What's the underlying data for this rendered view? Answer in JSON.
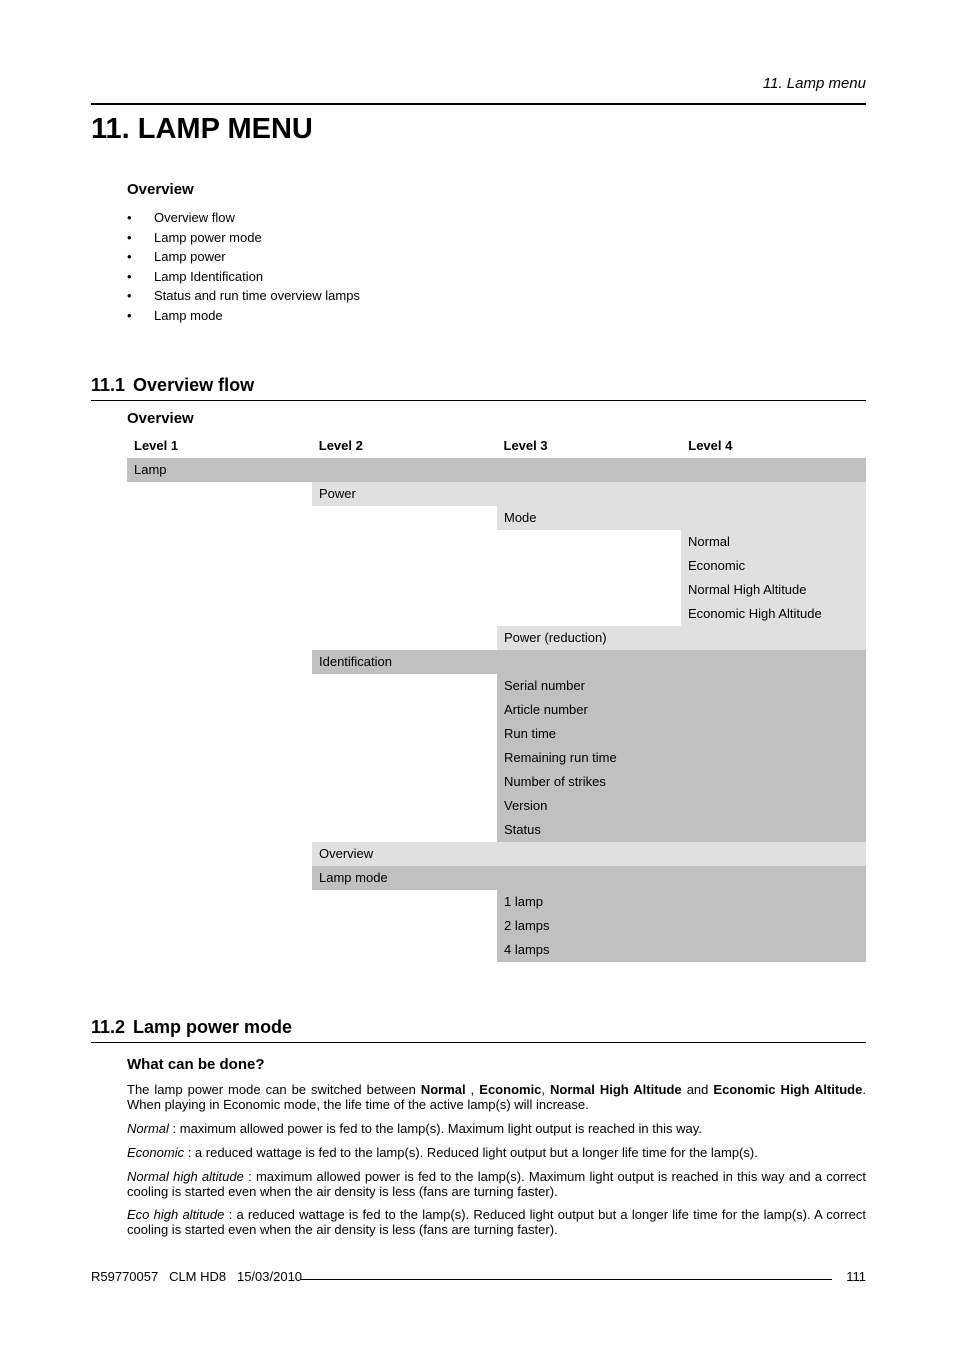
{
  "running_header": "11.  Lamp menu",
  "chapter_title": "11. LAMP MENU",
  "overview": {
    "heading": "Overview",
    "items": [
      "Overview flow",
      "Lamp power mode",
      "Lamp power",
      "Lamp Identification",
      "Status and run time overview lamps",
      "Lamp mode"
    ]
  },
  "section_1": {
    "number": "11.1",
    "title": "Overview flow",
    "subheading": "Overview",
    "columns": [
      "Level 1",
      "Level 2",
      "Level 3",
      "Level 4"
    ],
    "rows": [
      {
        "level": 1,
        "text": "Lamp",
        "shade": "dark"
      },
      {
        "level": 2,
        "text": "Power",
        "shade": "light"
      },
      {
        "level": 3,
        "text": "Mode",
        "shade": "light"
      },
      {
        "level": 4,
        "text": "Normal",
        "shade": "light"
      },
      {
        "level": 4,
        "text": "Economic",
        "shade": "light"
      },
      {
        "level": 4,
        "text": "Normal High Altitude",
        "shade": "light"
      },
      {
        "level": 4,
        "text": "Economic High Altitude",
        "shade": "light"
      },
      {
        "level": 3,
        "text": "Power (reduction)",
        "shade": "light"
      },
      {
        "level": 2,
        "text": "Identification",
        "shade": "dark"
      },
      {
        "level": 3,
        "text": "Serial number",
        "shade": "dark"
      },
      {
        "level": 3,
        "text": "Article number",
        "shade": "dark"
      },
      {
        "level": 3,
        "text": "Run time",
        "shade": "dark"
      },
      {
        "level": 3,
        "text": "Remaining run time",
        "shade": "dark"
      },
      {
        "level": 3,
        "text": "Number of strikes",
        "shade": "dark"
      },
      {
        "level": 3,
        "text": "Version",
        "shade": "dark"
      },
      {
        "level": 3,
        "text": "Status",
        "shade": "dark"
      },
      {
        "level": 2,
        "text": "Overview",
        "shade": "light"
      },
      {
        "level": 2,
        "text": "Lamp mode",
        "shade": "dark"
      },
      {
        "level": 3,
        "text": "1 lamp",
        "shade": "dark"
      },
      {
        "level": 3,
        "text": "2 lamps",
        "shade": "dark"
      },
      {
        "level": 3,
        "text": "4 lamps",
        "shade": "dark"
      }
    ]
  },
  "section_2": {
    "number": "11.2",
    "title": "Lamp power mode",
    "subheading": "What can be done?",
    "intro": {
      "t1": "The lamp power mode can be switched between ",
      "b1": "Normal",
      "t2": " , ",
      "b2": "Economic",
      "t3": ", ",
      "b3": "Normal High Altitude",
      "t4": " and ",
      "b4": "Economic High Altitude",
      "t5": ". When playing in Economic mode, the life time of the active lamp(s) will increase."
    },
    "definitions": [
      {
        "term": "Normal",
        "sep": " : ",
        "text": "maximum allowed power is fed to the lamp(s). Maximum light output is reached in this way."
      },
      {
        "term": "Economic",
        "sep": " : ",
        "text": "a reduced wattage is fed to the lamp(s). Reduced light output but a longer life time for the lamp(s)."
      },
      {
        "term": "Normal high altitude",
        "sep": " : ",
        "text": "maximum allowed power is fed to the lamp(s). Maximum light output is reached in this way and a correct cooling is started even when the air density is less (fans are turning faster)."
      },
      {
        "term": "Eco high altitude",
        "sep": " : ",
        "text": "a reduced wattage is fed to the lamp(s). Reduced light output but a longer life time for the lamp(s). A correct cooling is started even when the air density is less (fans are turning faster)."
      }
    ]
  },
  "footer": {
    "doc_info": "R59770057   CLM HD8   15/03/2010",
    "page_number": "111"
  }
}
